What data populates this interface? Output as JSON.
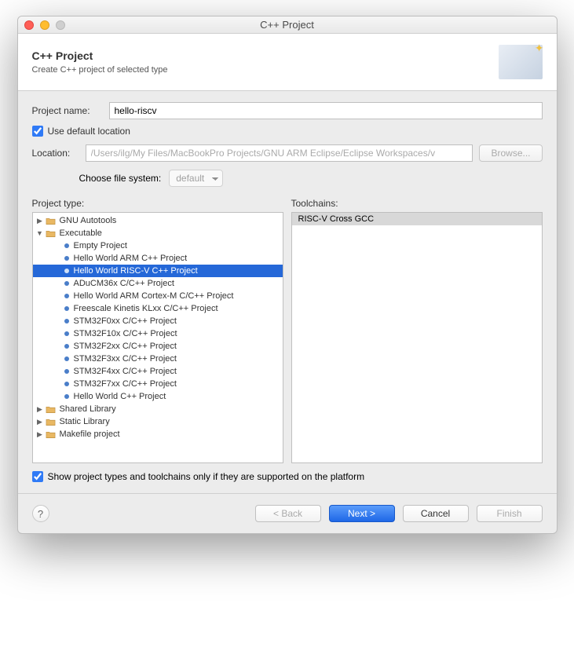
{
  "window": {
    "title": "C++ Project"
  },
  "header": {
    "title": "C++ Project",
    "subtitle": "Create C++ project of selected type"
  },
  "fields": {
    "project_name_label": "Project name:",
    "project_name_value": "hello-riscv",
    "use_default_location_label": "Use default location",
    "location_label": "Location:",
    "location_value": "/Users/ilg/My Files/MacBookPro Projects/GNU ARM Eclipse/Eclipse Workspaces/v",
    "browse_label": "Browse...",
    "choose_fs_label": "Choose file system:",
    "fs_value": "default"
  },
  "split": {
    "project_type_label": "Project type:",
    "toolchains_label": "Toolchains:"
  },
  "tree": {
    "gnu_autotools": "GNU Autotools",
    "executable": "Executable",
    "children": [
      "Empty Project",
      "Hello World ARM C++ Project",
      "Hello World RISC-V C++ Project",
      "ADuCM36x C/C++ Project",
      "Hello World ARM Cortex-M C/C++ Project",
      "Freescale Kinetis KLxx C/C++ Project",
      "STM32F0xx C/C++ Project",
      "STM32F10x C/C++ Project",
      "STM32F2xx C/C++ Project",
      "STM32F3xx C/C++ Project",
      "STM32F4xx C/C++ Project",
      "STM32F7xx C/C++ Project",
      "Hello World C++ Project"
    ],
    "shared_library": "Shared Library",
    "static_library": "Static Library",
    "makefile_project": "Makefile project"
  },
  "toolchains": {
    "items": [
      "RISC-V Cross GCC"
    ]
  },
  "footer": {
    "show_supported_label": "Show project types and toolchains only if they are supported on the platform"
  },
  "buttons": {
    "back": "< Back",
    "next": "Next >",
    "cancel": "Cancel",
    "finish": "Finish"
  }
}
